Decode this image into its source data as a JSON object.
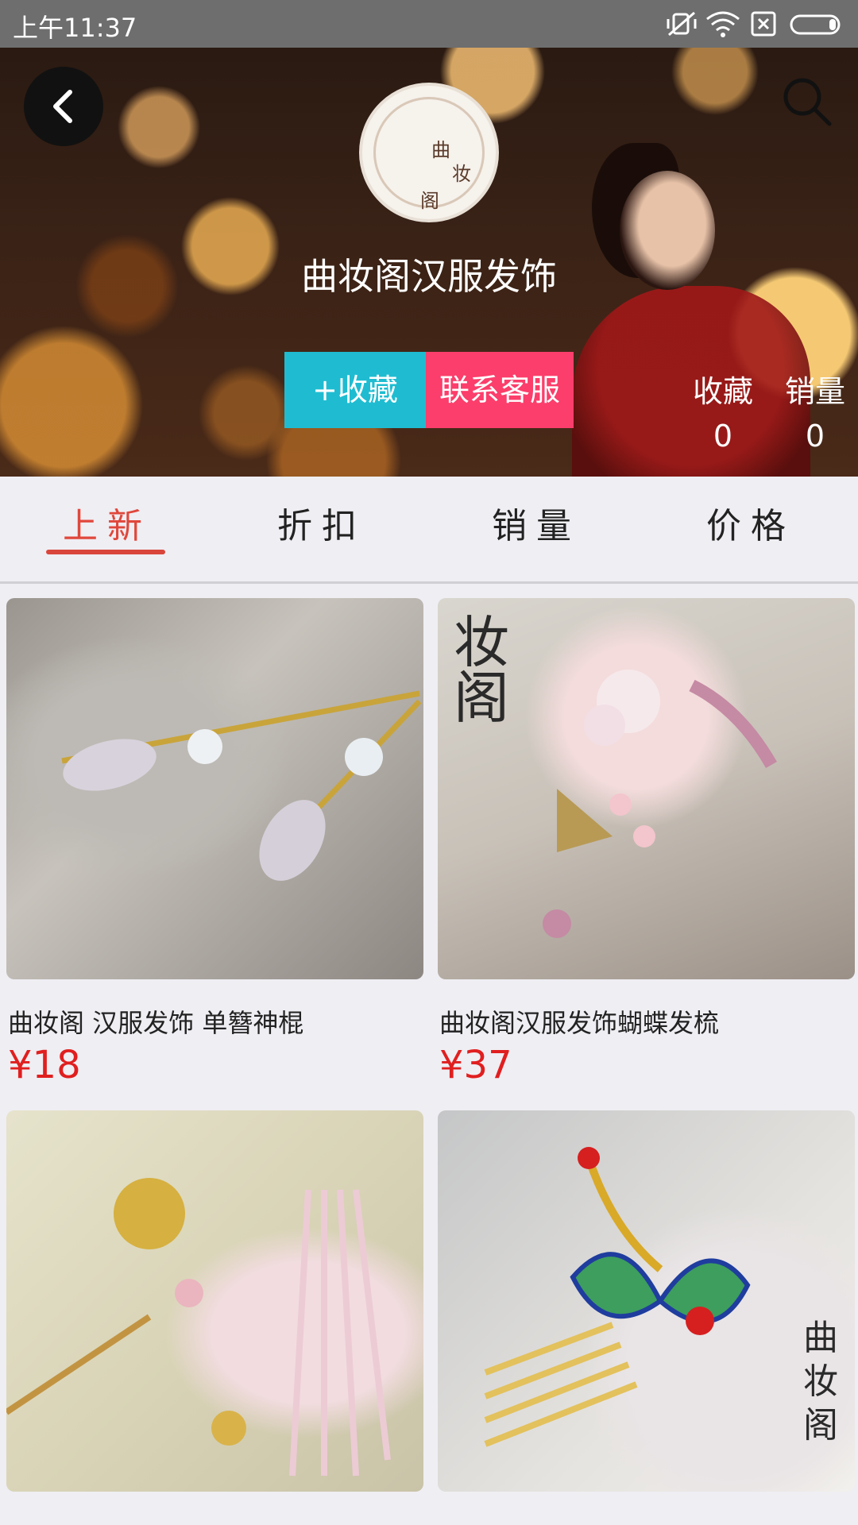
{
  "status_bar": {
    "time": "上午11:37"
  },
  "header": {
    "shop_name": "曲妆阁汉服发饰",
    "logo_chars": [
      "曲",
      "妆",
      "阁"
    ],
    "favorite_button": "+收藏",
    "service_button": "联系客服",
    "stats": [
      {
        "label": "收藏",
        "value": "0"
      },
      {
        "label": "销量",
        "value": "0"
      }
    ]
  },
  "tabs": [
    {
      "label": "上新",
      "active": true
    },
    {
      "label": "折扣",
      "active": false
    },
    {
      "label": "销量",
      "active": false
    },
    {
      "label": "价格",
      "active": false
    }
  ],
  "products": [
    {
      "name": "曲妆阁 汉服发饰 单簪神棍",
      "price": "¥18"
    },
    {
      "name": "曲妆阁汉服发饰蝴蝶发梳",
      "price": "¥37"
    },
    {
      "name": "",
      "price": ""
    },
    {
      "name": "",
      "price": ""
    }
  ],
  "colors": {
    "accent_tab": "#e0473b",
    "favorite_button": "#1fbcd1",
    "service_button": "#fb3e6b",
    "price": "#e01f1f"
  }
}
